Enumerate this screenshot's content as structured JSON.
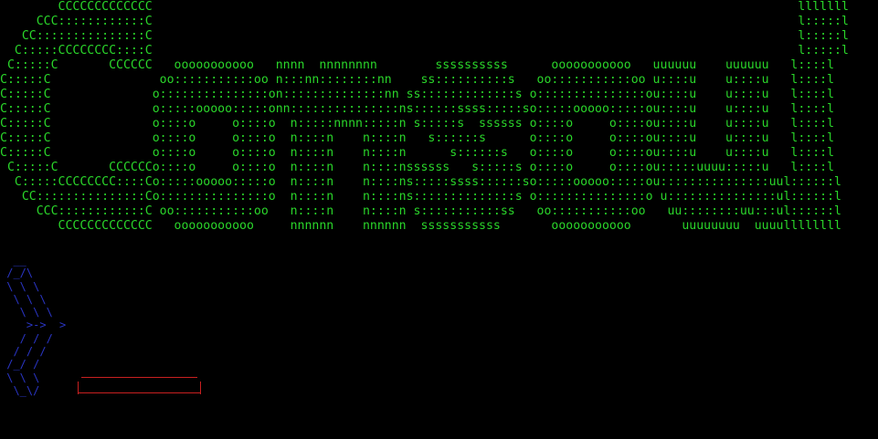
{
  "colors": {
    "background": "#000000",
    "banner": "#2ad62a",
    "prompt_art": "#2a35c4",
    "input_border": "#c82020"
  },
  "banner": {
    "lines": [
      "        CCCCCCCCCCCCC                                                                                         lllllll",
      "     CCC::::::::::::C                                                                                         l:::::l",
      "   CC:::::::::::::::C                                                                                         l:::::l",
      "  C:::::CCCCCCCC::::C                                                                                         l:::::l",
      " C:::::C       CCCCCC   ooooooooooo   nnnn  nnnnnnnn        ssssssssss      ooooooooooo   uuuuuu    uuuuuu   l::::l",
      "C:::::C               oo:::::::::::oo n:::nn::::::::nn    ss::::::::::s   oo:::::::::::oo u::::u    u::::u   l::::l",
      "C:::::C              o:::::::::::::::on::::::::::::::nn ss:::::::::::::s o:::::::::::::::ou::::u    u::::u   l::::l",
      "C:::::C              o:::::ooooo:::::onn:::::::::::::::ns::::::ssss:::::so:::::ooooo:::::ou::::u    u::::u   l::::l",
      "C:::::C              o::::o     o::::o  n:::::nnnn:::::n s:::::s  ssssss o::::o     o::::ou::::u    u::::u   l::::l",
      "C:::::C              o::::o     o::::o  n::::n    n::::n   s::::::s      o::::o     o::::ou::::u    u::::u   l::::l",
      "C:::::C              o::::o     o::::o  n::::n    n::::n      s::::::s   o::::o     o::::ou::::u    u::::u   l::::l",
      " C:::::C       CCCCCCo::::o     o::::o  n::::n    n::::nssssss   s:::::s o::::o     o::::ou:::::uuuu:::::u   l::::l",
      "  C:::::CCCCCCCC::::Co:::::ooooo:::::o  n::::n    n::::ns:::::ssss::::::so:::::ooooo:::::ou:::::::::::::::uul::::::l",
      "   CC:::::::::::::::Co:::::::::::::::o  n::::n    n::::ns::::::::::::::s o:::::::::::::::o u:::::::::::::::ul::::::l",
      "     CCC::::::::::::C oo:::::::::::oo   n::::n    n::::n s:::::::::::ss   oo:::::::::::oo   uu::::::::uu:::ul::::::l",
      "        CCCCCCCCCCCCC   ooooooooooo     nnnnnn    nnnnnn  sssssssssss       ooooooooooo       uuuuuuuu  uuuullllllll"
    ]
  },
  "prompt_art": {
    "lines": [
      "  __",
      " /_/\\",
      " \\ \\ \\",
      "  \\ \\ \\",
      "   \\ \\ \\",
      "    >->  >",
      "   / / /",
      "  / / /",
      " /_/ /",
      " \\ \\ \\",
      "  \\_\\/"
    ]
  },
  "input": {
    "value": "",
    "placeholder": ""
  }
}
